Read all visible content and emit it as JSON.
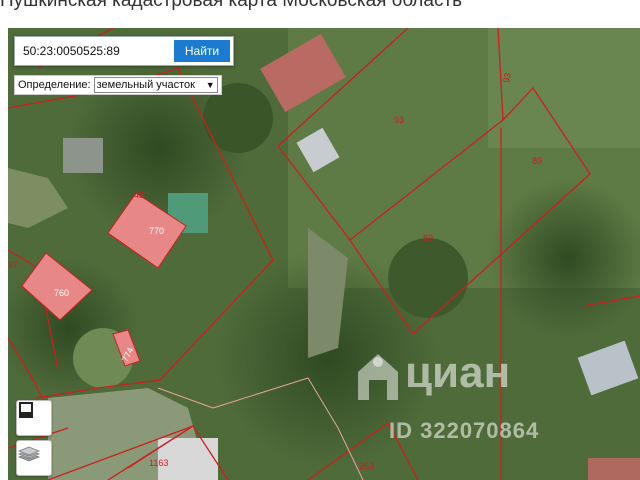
{
  "page": {
    "title": "Пушкинская кадастровая карта Московская область"
  },
  "search": {
    "value": "50:23:0050525:89",
    "button_label": "Найти"
  },
  "definition": {
    "label": "Определение:",
    "selected": "земельный участок"
  },
  "map": {
    "parcel_labels": [
      "93",
      "93",
      "89",
      "89",
      "43",
      "770",
      "97",
      "760",
      "774",
      "1163",
      "263"
    ],
    "boundary_color": "#cc1f1f",
    "building_color": "#e88787"
  },
  "controls": {
    "ruler_icon": "ruler-icon",
    "layers_icon": "layers-icon"
  },
  "watermark": {
    "name": "циан",
    "id": "ID 322070864"
  }
}
